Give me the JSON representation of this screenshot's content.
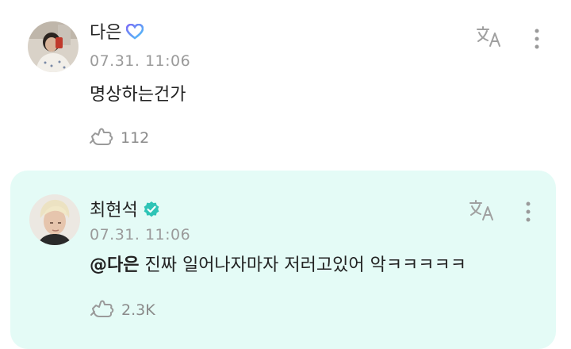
{
  "posts": [
    {
      "author": "다은",
      "badge": "heart-badge",
      "timestamp": "07.31. 11:06",
      "body": "명상하는건가",
      "mention": "",
      "reaction_count": "112",
      "reaction_icon": "hand-like-icon"
    },
    {
      "author": "최현석",
      "badge": "verified-check-badge",
      "timestamp": "07.31. 11:06",
      "mention": "@다은",
      "body": " 진짜 일어나자마자 저러고있어 악ㅋㅋㅋㅋㅋ",
      "reaction_count": "2.3K",
      "reaction_icon": "hand-like-icon"
    }
  ],
  "colors": {
    "highlight_background": "#e4fbf6",
    "verified_badge": "#2ec4b6",
    "heart_gradient_start": "#7b6cf6",
    "heart_gradient_end": "#4fc3f7",
    "meta_text": "#9a9a9a"
  }
}
